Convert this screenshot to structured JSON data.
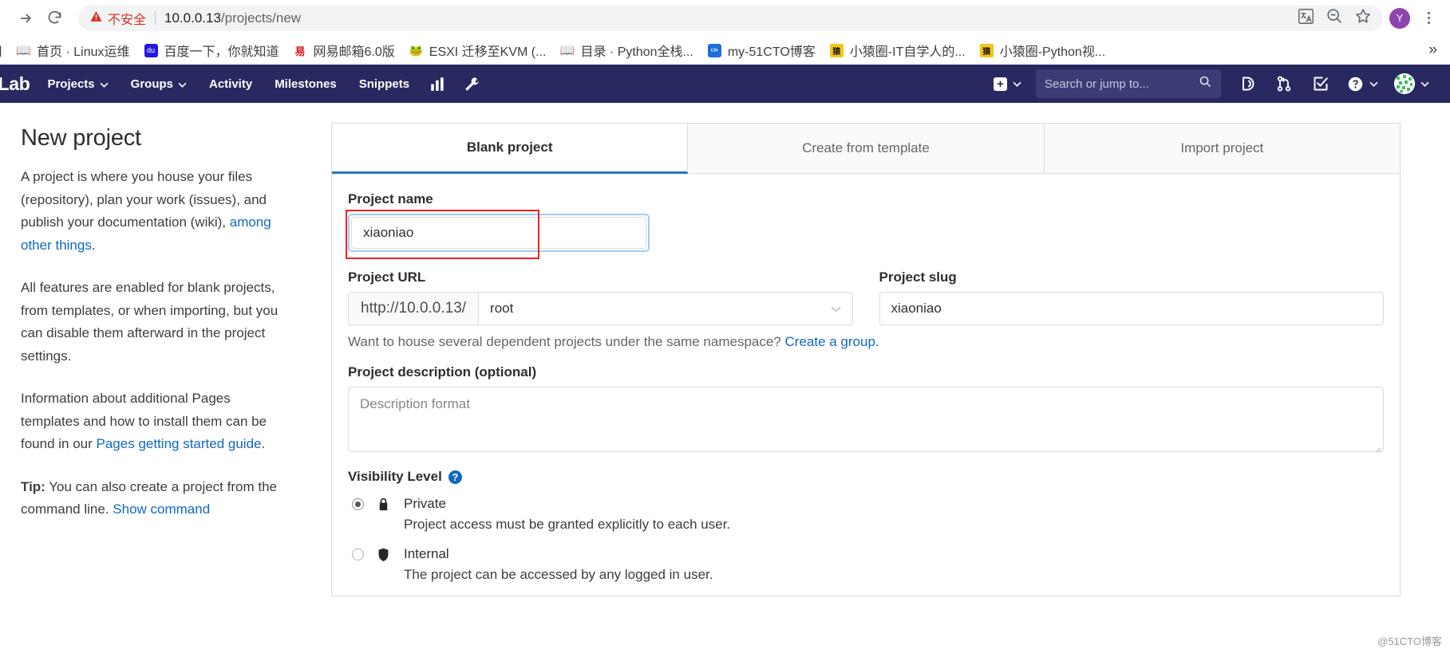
{
  "browser": {
    "reload_icon": "reload-icon",
    "security_warning": "不安全",
    "url_host": "10.0.0.13",
    "url_path": "/projects/new",
    "translate_icon": "translate-icon",
    "zoom_icon": "zoom-out-icon",
    "bookmark_icon": "star-icon",
    "profile_initial": "Y",
    "menu_icon": "kebab-menu-icon",
    "bookmarks_overflow": "»",
    "bookmarks": [
      {
        "label": "用",
        "icon": "partial-bookmark-icon"
      },
      {
        "label": "首页 · Linux运维",
        "icon": "book-icon"
      },
      {
        "label": "百度一下，你就知道",
        "icon": "baidu-icon"
      },
      {
        "label": "网易邮箱6.0版",
        "icon": "netease-icon"
      },
      {
        "label": "ESXI 迁移至KVM (...",
        "icon": "frog-icon"
      },
      {
        "label": "目录 · Python全栈...",
        "icon": "book-icon"
      },
      {
        "label": "my-51CTO博客",
        "icon": "51cto-icon"
      },
      {
        "label": "小猿圈-IT自学人的...",
        "icon": "yuan-icon"
      },
      {
        "label": "小猿圈-Python视...",
        "icon": "yuan-icon"
      }
    ]
  },
  "gitlab_nav": {
    "logo_text": "itLab",
    "items": [
      {
        "label": "Projects",
        "caret": true
      },
      {
        "label": "Groups",
        "caret": true
      },
      {
        "label": "Activity",
        "caret": false
      },
      {
        "label": "Milestones",
        "caret": false
      },
      {
        "label": "Snippets",
        "caret": false
      }
    ],
    "icon_items": [
      {
        "name": "analytics-icon"
      },
      {
        "name": "wrench-admin-icon"
      }
    ],
    "new_dropdown": {
      "icon": "plus-square-icon",
      "caret": "⌄"
    },
    "search_placeholder": "Search or jump to...",
    "search_icon": "search-icon",
    "right_icons": [
      {
        "name": "issues-icon"
      },
      {
        "name": "merge-requests-icon"
      },
      {
        "name": "todos-icon"
      },
      {
        "name": "help-icon",
        "caret": "⌄"
      }
    ],
    "avatar": {
      "name": "user-avatar",
      "caret": "⌄"
    },
    "bg_color": "#292961"
  },
  "aside": {
    "title": "New project",
    "paragraph1_plain": "A project is where you house your files (repository), plan your work (issues), and publish your documentation (wiki), ",
    "paragraph1_link": "among other things",
    "paragraph1_tail": ".",
    "paragraph2": "All features are enabled for blank projects, from templates, or when importing, but you can disable them afterward in the project settings.",
    "paragraph3_plain": "Information about additional Pages templates and how to install them can be found in our ",
    "paragraph3_link": "Pages getting started guide",
    "paragraph3_tail": ".",
    "tip_label": "Tip:",
    "tip_text": " You can also create a project from the command line. ",
    "tip_link": "Show command"
  },
  "main": {
    "tabs": [
      {
        "label": "Blank project",
        "active": true
      },
      {
        "label": "Create from template",
        "active": false
      },
      {
        "label": "Import project",
        "active": false
      }
    ],
    "project_name": {
      "label": "Project name",
      "value": "xiaoniao"
    },
    "project_url": {
      "label": "Project URL",
      "prefix": "http://10.0.0.13/",
      "namespace": "root",
      "caret": "⌄"
    },
    "project_slug": {
      "label": "Project slug",
      "value": "xiaoniao"
    },
    "namespace_hint_text": "Want to house several dependent projects under the same namespace? ",
    "namespace_hint_link": "Create a group.",
    "description": {
      "label": "Project description (optional)",
      "placeholder": "Description format"
    },
    "visibility": {
      "label": "Visibility Level",
      "help_icon": "question-mark-icon",
      "options": [
        {
          "title": "Private",
          "desc": "Project access must be granted explicitly to each user.",
          "icon": "lock-icon",
          "selected": true
        },
        {
          "title": "Internal",
          "desc": "The project can be accessed by any logged in user.",
          "icon": "shield-icon",
          "selected": false
        }
      ]
    }
  },
  "watermark": "@51CTO博客",
  "colors": {
    "gitlab_purple": "#292961",
    "link_blue": "#1068bf",
    "active_tab_underline": "#1f75cb",
    "annotation_red": "#ee2222",
    "warning_red": "#d93025"
  }
}
